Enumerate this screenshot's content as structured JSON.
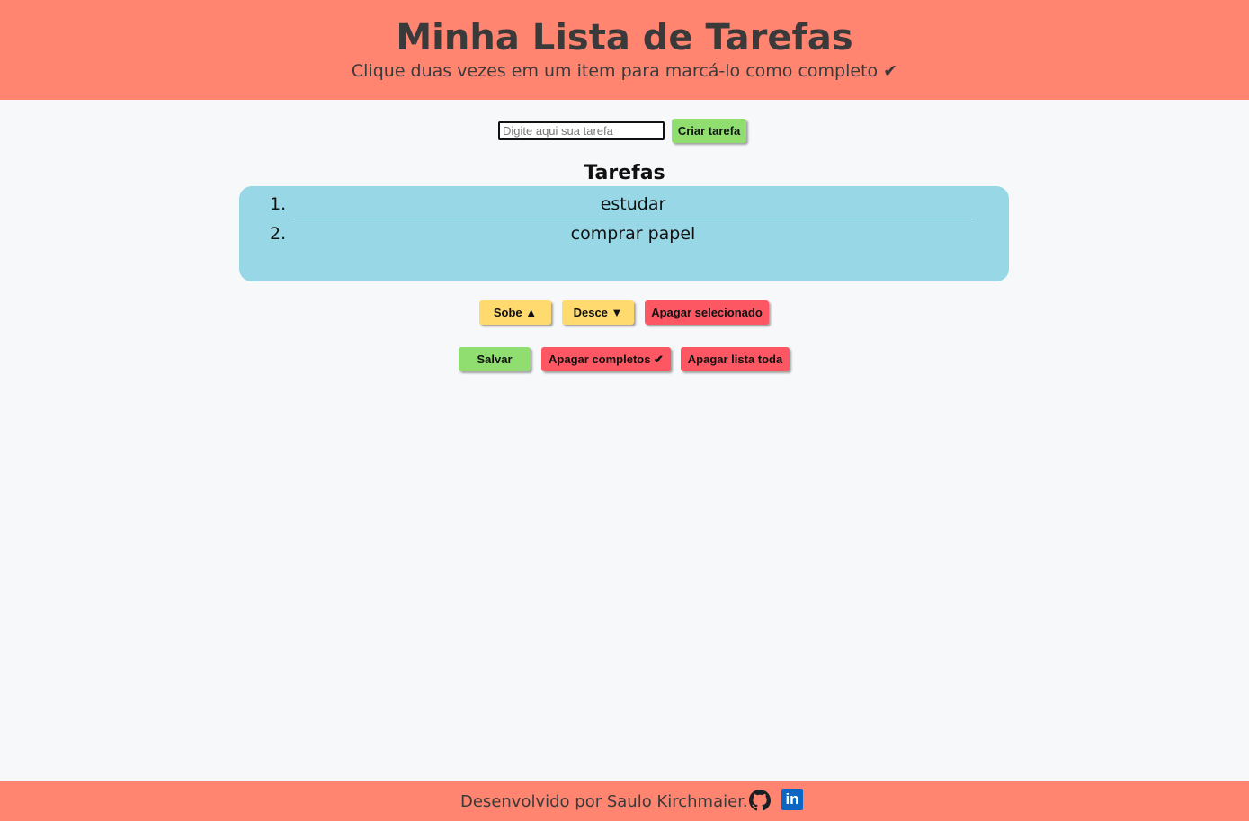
{
  "header": {
    "title": "Minha Lista de Tarefas",
    "subtitle": "Clique duas vezes em um item para marcá-lo como completo ✔"
  },
  "create": {
    "placeholder": "Digite aqui sua tarefa",
    "value": "",
    "button_label": "Criar tarefa"
  },
  "tasks": {
    "title": "Tarefas",
    "items": [
      {
        "number": "1.",
        "label": "estudar"
      },
      {
        "number": "2.",
        "label": "comprar papel"
      }
    ]
  },
  "controls": {
    "up_label": "Sobe ▲",
    "down_label": "Desce ▼",
    "delete_selected_label": "Apagar selecionado",
    "save_label": "Salvar",
    "delete_completed_label": "Apagar completos ✔",
    "delete_all_label": "Apagar lista toda"
  },
  "footer": {
    "credit": "Desenvolvido por Saulo Kirchmaier.",
    "github_icon": "github-icon",
    "linkedin_icon": "linkedin-icon",
    "linkedin_text": "in"
  },
  "colors": {
    "header_bg": "#ff8571",
    "list_bg": "#98d8e6",
    "green": "#8fde6f",
    "yellow": "#ffdb6f",
    "red": "#fd5763"
  }
}
